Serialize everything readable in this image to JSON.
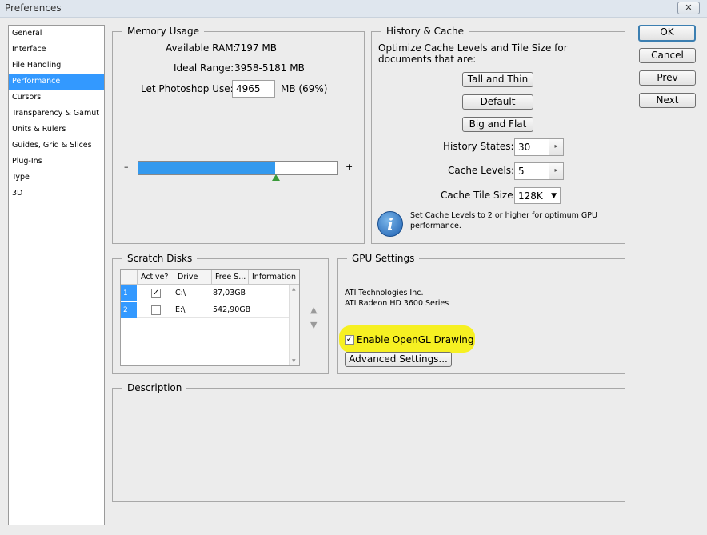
{
  "window": {
    "title": "Preferences",
    "close_glyph": "✕"
  },
  "sidebar": {
    "items": [
      "General",
      "Interface",
      "File Handling",
      "Performance",
      "Cursors",
      "Transparency & Gamut",
      "Units & Rulers",
      "Guides, Grid & Slices",
      "Plug-Ins",
      "Type",
      "3D"
    ],
    "selected_index": 3
  },
  "memory": {
    "title": "Memory Usage",
    "available_label": "Available RAM:",
    "available_value": "7197 MB",
    "ideal_label": "Ideal Range:",
    "ideal_value": "3958-5181 MB",
    "let_label": "Let Photoshop Use:",
    "let_value": "4965",
    "let_unit": "MB (69%)",
    "minus": "–",
    "plus": "+",
    "slider_fraction": 0.69
  },
  "history": {
    "title": "History & Cache",
    "description": "Optimize Cache Levels and Tile Size for documents that are:",
    "btn_tall": "Tall and Thin",
    "btn_default": "Default",
    "btn_big": "Big and Flat",
    "states_label": "History States:",
    "states_value": "30",
    "levels_label": "Cache Levels:",
    "levels_value": "5",
    "tile_label": "Cache Tile Size:",
    "tile_value": "128K",
    "info_glyph": "i",
    "info_text": "Set Cache Levels to 2 or higher for optimum GPU performance."
  },
  "scratch": {
    "title": "Scratch Disks",
    "columns": [
      "Active?",
      "Drive",
      "Free S...",
      "Information"
    ],
    "rows": [
      {
        "num": "1",
        "active": "✓",
        "drive": "C:\\",
        "free": "87,03GB",
        "info": ""
      },
      {
        "num": "2",
        "active": "",
        "drive": "E:\\",
        "free": "542,90GB",
        "info": ""
      }
    ],
    "up_glyph": "▲",
    "down_glyph": "▼"
  },
  "gpu": {
    "title": "GPU Settings",
    "vendor": "ATI Technologies Inc.",
    "model": "ATI Radeon HD 3600 Series",
    "opengl_label": "Enable OpenGL Drawing",
    "opengl_check": "✓",
    "advanced_label": "Advanced Settings..."
  },
  "description": {
    "title": "Description"
  },
  "buttons": {
    "ok": "OK",
    "cancel": "Cancel",
    "prev": "Prev",
    "next": "Next"
  },
  "colors": {
    "selection": "#3399ff",
    "highlight": "#f6f022",
    "meter": "#3399ee"
  }
}
